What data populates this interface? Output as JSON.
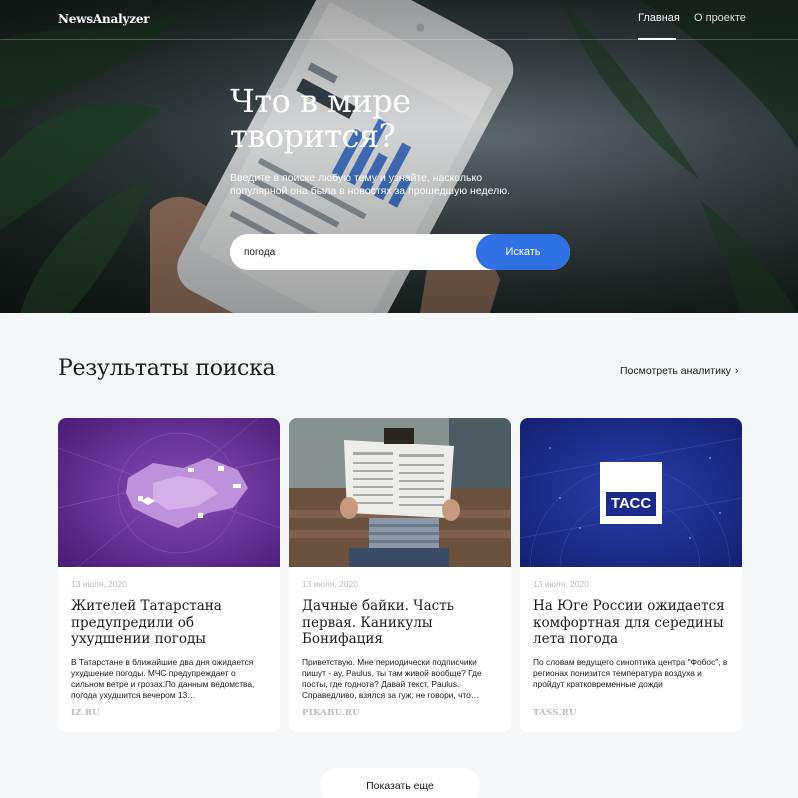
{
  "header": {
    "logo": "NewsAnalyzer",
    "nav": [
      {
        "label": "Главная",
        "active": true
      },
      {
        "label": "О проекте",
        "active": false
      }
    ]
  },
  "hero": {
    "title": "Что в мире творится?",
    "subtitle": "Введите в поиске любую тему и узнайте, насколько популярной она была в новостях за прошедшую неделю.",
    "search": {
      "value": "погода",
      "button_label": "Искать"
    },
    "phone_screen": {
      "header": "Insights",
      "tabs": [
        "ACTIVITY",
        "CONTENT",
        "AUDIENCE"
      ],
      "section": "Interactions",
      "big_number": "1,459",
      "rows": [
        "Website Visits",
        "Emails",
        "Get Directions",
        "Calls"
      ],
      "footer_number": "110"
    }
  },
  "results": {
    "title": "Результаты поиска",
    "analytics_link": "Посмотреть аналитику",
    "cards": [
      {
        "date": "13 июля, 2020",
        "title": "Жителей Татарстана предупредили об ухудшении погоды",
        "text": "В Татарстане в ближайшие два дня ожидается ухудшение погоды. МЧС предупреждает о сильном ветре и грозах.По данным ведомства, погода ухудшится вечером 13…",
        "source": "IZ.RU"
      },
      {
        "date": "13 июля, 2020",
        "title": "Дачные байки. Часть первая. Каникулы Бонифация",
        "text": "Приветствую. Мне периодически подписчики пишут - ау, Paulus, ты там живой вообще? Где посты, где годнота? Давай текст, Paulus. Справедливо, взялся за гуж, не говори, что…",
        "source": "PIKABU.RU"
      },
      {
        "date": "13 июля, 2020",
        "title": "На Юге России ожидается комфортная для середины лета погода",
        "text": "По словам ведущего синоптика центра \"Фобос\", в регионах понизится температура воздуха и пройдут кратковременные дожди",
        "source": "TASS.RU",
        "logo_text": "ТАСС"
      }
    ],
    "more_button": "Показать еще"
  },
  "colors": {
    "accent": "#2f71e5",
    "page_bg": "#f5f6f7",
    "muted": "#b6bcbf",
    "card1_bg": "#5b2a8a",
    "card3_bg": "#1b2a8c"
  }
}
